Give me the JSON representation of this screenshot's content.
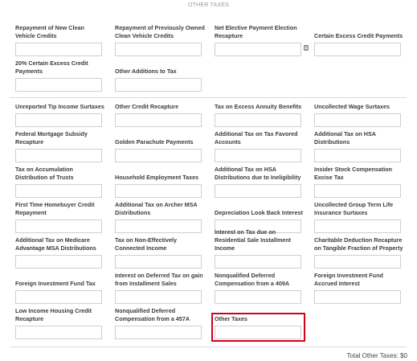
{
  "section_title": "OTHER TAXES",
  "fields": [
    {
      "label": "Repayment of New Clean Vehicle Credits",
      "value": ""
    },
    {
      "label": "Repayment of Previously Owned Clean Vehicle Credits",
      "value": ""
    },
    {
      "label": "Net Elective Payment Election Recapture",
      "value": ""
    },
    {
      "label": "Certain Excess Credit Payments",
      "value": ""
    },
    {
      "label": "20% Certain Excess Credit Payments",
      "value": ""
    },
    {
      "label": "Other Additions to Tax",
      "value": ""
    },
    {
      "label": "Unreported Tip Income Surtaxes",
      "value": ""
    },
    {
      "label": "Other Credit Recapture",
      "value": ""
    },
    {
      "label": "Tax on Excess Annuity Benefits",
      "value": ""
    },
    {
      "label": "Uncollected Wage Surtaxes",
      "value": ""
    },
    {
      "label": "Federal Mortgage Subsidy Recapture",
      "value": ""
    },
    {
      "label": "Golden Parachute Payments",
      "value": ""
    },
    {
      "label": "Additional Tax on Tax Favored Accounts",
      "value": ""
    },
    {
      "label": "Additional Tax on HSA Distributions",
      "value": ""
    },
    {
      "label": "Tax on Accumulation Distribution of Trusts",
      "value": ""
    },
    {
      "label": "Household Employment Taxes",
      "value": ""
    },
    {
      "label": "Additional Tax on HSA Distributions due to Ineligibility",
      "value": ""
    },
    {
      "label": "Insider Stock Compensation Excise Tax",
      "value": ""
    },
    {
      "label": "First Time Homebuyer Credit Repayment",
      "value": ""
    },
    {
      "label": "Additional Tax on Archer MSA Distributions",
      "value": ""
    },
    {
      "label": "Depreciation Look Back Interest",
      "value": ""
    },
    {
      "label": "Uncollected Group Term Life Insurance Surtaxes",
      "value": ""
    },
    {
      "label": "Additional Tax on Medicare Advantage MSA Distributions",
      "value": ""
    },
    {
      "label": "Tax on Non-Effectively Connected Income",
      "value": ""
    },
    {
      "label": "Interest on Tax due on Residential Sale Installment Income",
      "value": ""
    },
    {
      "label": "Charitable Deduction Recapture on Tangible Fraction of Property",
      "value": ""
    },
    {
      "label": "Foreign Investment Fund Tax",
      "value": ""
    },
    {
      "label": "Interest on Deferred Tax on gain from Installment Sales",
      "value": ""
    },
    {
      "label": "Nonqualified Deferred Compensation from a 409A",
      "value": ""
    },
    {
      "label": "Foreign Investment Fund Accrued Interest",
      "value": ""
    },
    {
      "label": "Low Income Housing Credit Recapture",
      "value": ""
    },
    {
      "label": "Nonqualified Deferred Compensation from a 457A",
      "value": ""
    },
    {
      "label": "Other Taxes",
      "value": ""
    }
  ],
  "icons": {
    "calculator": "calculator-icon"
  },
  "total": {
    "label": "Total Other Taxes:",
    "value": "$0"
  }
}
